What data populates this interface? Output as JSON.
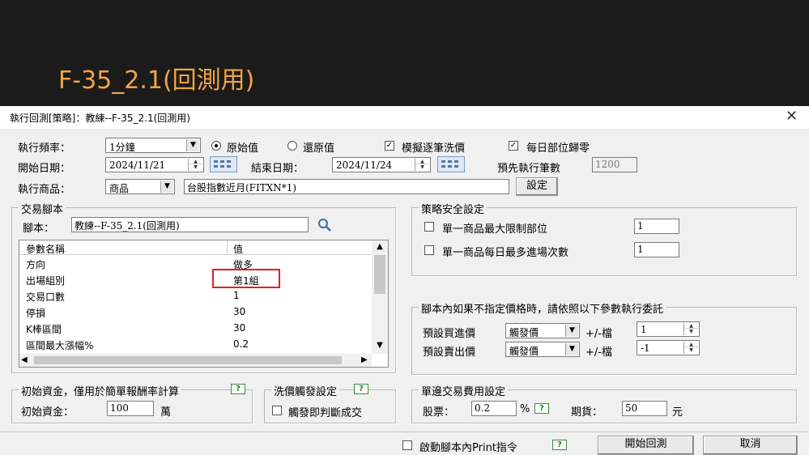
{
  "slide": {
    "title": "F-35_2.1(回測用)"
  },
  "dialog": {
    "title": "執行回測[策略]：教練--F-35_2.1(回測用)",
    "close_glyph": "✕"
  },
  "top": {
    "freq_label": "執行頻率：",
    "freq_value": "1分鐘",
    "radio_original": "原始值",
    "radio_restored": "還原值",
    "chk_sim_wash": "模擬逐筆洗價",
    "chk_daily_reset": "每日部位歸零",
    "start_label": "開始日期：",
    "start_value": "2024/11/21",
    "end_label": "結束日期：",
    "end_value": "2024/11/24",
    "prerun_label": "預先執行筆數",
    "prerun_value": "1200",
    "product_label": "執行商品：",
    "product_type": "商品",
    "product_value": "台股指數近月(FITXN*1)",
    "set_button": "設定"
  },
  "script": {
    "group_title": "交易腳本",
    "script_label": "腳本：",
    "script_value": "教練--F-35_2.1(回測用)",
    "col_name": "參數名稱",
    "col_value": "值",
    "rows": [
      {
        "name": "方向",
        "value": "做多"
      },
      {
        "name": "出場組別",
        "value": "第1組"
      },
      {
        "name": "交易口數",
        "value": "1"
      },
      {
        "name": "停損",
        "value": "30"
      },
      {
        "name": "K棒區間",
        "value": "30"
      },
      {
        "name": "區間最大漲幅%",
        "value": "0.2"
      }
    ]
  },
  "safety": {
    "group_title": "策略安全設定",
    "max_position_label": "單一商品最大限制部位",
    "max_position_value": "1",
    "max_entries_label": "單一商品每日最多進場次數",
    "max_entries_value": "1"
  },
  "order": {
    "group_title": "腳本內如果不指定價格時，請依照以下參數執行委託",
    "buy_label": "預設買進價",
    "buy_value": "觸發價",
    "buy_tick_label": "+/-檔",
    "buy_tick_value": "1",
    "sell_label": "預設賣出價",
    "sell_value": "觸發價",
    "sell_tick_label": "+/-檔",
    "sell_tick_value": "-1"
  },
  "capital": {
    "group_title": "初始資金，僅用於簡單報酬率計算",
    "label": "初始資金：",
    "value": "100",
    "unit": "萬"
  },
  "wash": {
    "group_title": "洗價觸發設定",
    "chk_label": "觸發即判斷成交"
  },
  "fee": {
    "group_title": "單邊交易費用設定",
    "stock_label": "股票：",
    "stock_value": "0.2",
    "stock_unit": "%",
    "futures_label": "期貨：",
    "futures_value": "50",
    "futures_unit": "元"
  },
  "footer": {
    "chk_print": "啟動腳本內Print指令",
    "start_button": "開始回測",
    "cancel_button": "取消"
  },
  "help_text": "?",
  "check_mark": "✓",
  "colors": {
    "title_orange": "#f2a541",
    "highlight_red": "#e02020",
    "help_green": "#2a7a2a"
  }
}
